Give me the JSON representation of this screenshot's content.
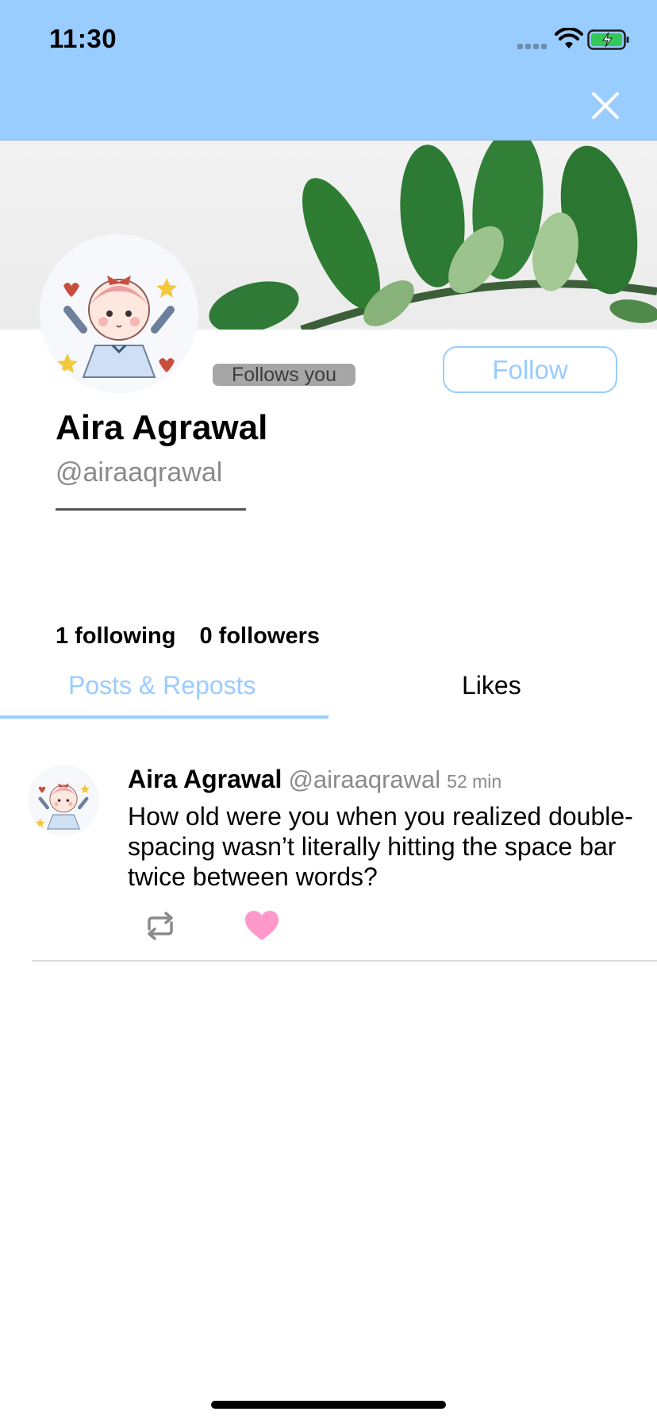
{
  "status_bar": {
    "time": "11:30"
  },
  "nav": {
    "close_icon": "close-icon"
  },
  "profile": {
    "display_name": "Aira Agrawal",
    "handle": "@airaaqrawal",
    "follows_you_label": "Follows you",
    "follow_button_label": "Follow",
    "following_text": "1 following",
    "followers_text": "0 followers"
  },
  "tabs": [
    {
      "label": "Posts & Reposts",
      "active": true
    },
    {
      "label": "Likes",
      "active": false
    }
  ],
  "post": {
    "author_name": "Aira Agrawal",
    "author_handle": "@airaaqrawal",
    "time_ago": "52 min",
    "text": "How old were you when you realized double-spacing wasn’t literally hitting the space bar twice between words?",
    "repost_icon": "repost-icon",
    "like_icon": "heart-icon",
    "liked": true
  },
  "colors": {
    "accent": "#99CCFF",
    "like": "#FF99CC",
    "muted_text": "#8A8A8A",
    "badge_bg": "#A6A6A6"
  }
}
